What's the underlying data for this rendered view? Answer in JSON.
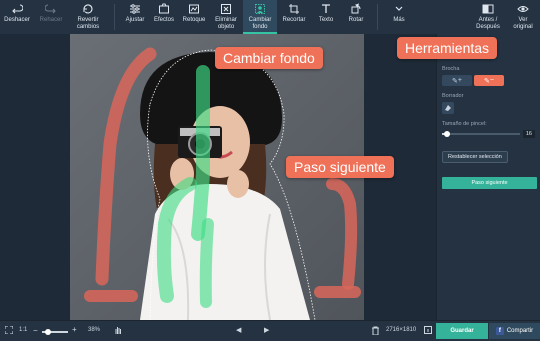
{
  "toolbar": {
    "items": [
      {
        "label": "Deshacer",
        "icon": "undo-icon"
      },
      {
        "label": "Rehacer",
        "icon": "redo-icon"
      },
      {
        "label": "Revertir\ncambios",
        "icon": "revert-icon"
      },
      {
        "label": "Ajustar",
        "icon": "adjust-icon"
      },
      {
        "label": "Efectos",
        "icon": "effects-icon"
      },
      {
        "label": "Retoque",
        "icon": "retouch-icon"
      },
      {
        "label": "Eliminar\nobjeto",
        "icon": "remove-object-icon"
      },
      {
        "label": "Cambiar\nfondo",
        "icon": "change-background-icon"
      },
      {
        "label": "Recortar",
        "icon": "crop-icon"
      },
      {
        "label": "Texto",
        "icon": "text-icon"
      },
      {
        "label": "Rotar",
        "icon": "rotate-icon"
      },
      {
        "label": "Más",
        "icon": "more-icon"
      },
      {
        "label": "Antes /\nDespués",
        "icon": "before-after-icon"
      },
      {
        "label": "Ver\noriginal",
        "icon": "eye-icon"
      }
    ]
  },
  "panel": {
    "brush_label": "Brocha",
    "brush_add": "+",
    "brush_remove": "−",
    "eraser_label": "Borrador",
    "brush_size_label": "Tamaño de pincel:",
    "brush_size_value": "16",
    "brush_size_fraction": 0.06,
    "reset_label": "Restablecer selección",
    "next_label": "Paso siguiente"
  },
  "bottom": {
    "ratio": "1:1",
    "zoom": "38%",
    "dimensions": "2716×1810",
    "save_label": "Guardar",
    "share_label": "Compartir"
  },
  "callouts": {
    "change_background": "Cambiar fondo",
    "tools": "Herramientas",
    "next_step": "Paso siguiente"
  },
  "colors": {
    "accent_orange": "#ee7158",
    "accent_green": "#35b39a",
    "toolbar_bg": "#243242"
  }
}
